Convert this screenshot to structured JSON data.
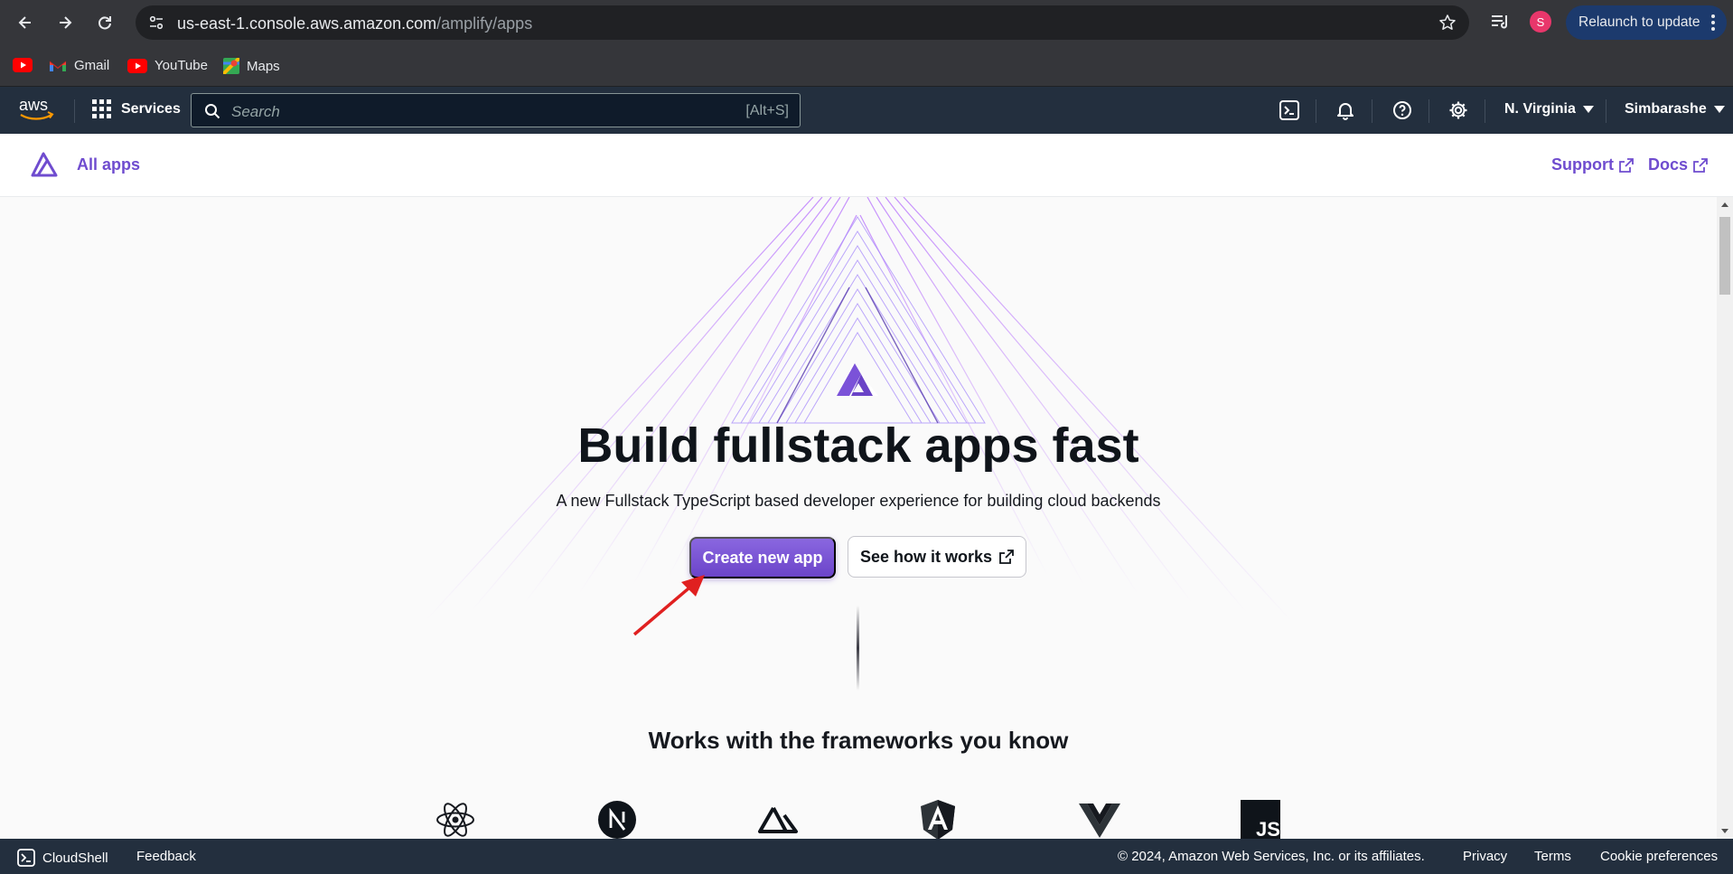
{
  "browser": {
    "url_host": "us-east-1.console.aws.amazon.com",
    "url_path": "/amplify/apps",
    "profile_initial": "S",
    "relaunch_label": "Relaunch to update",
    "bookmarks": [
      {
        "label": ""
      },
      {
        "label": "Gmail"
      },
      {
        "label": "YouTube"
      },
      {
        "label": "Maps"
      }
    ]
  },
  "aws_header": {
    "logo_text": "aws",
    "services_label": "Services",
    "search_placeholder": "Search",
    "search_shortcut": "[Alt+S]",
    "region": "N. Virginia",
    "account": "Simbarashe"
  },
  "amplify_header": {
    "all_apps": "All apps",
    "support": "Support",
    "docs": "Docs"
  },
  "hero": {
    "title": "Build fullstack apps fast",
    "subtitle": "A new Fullstack TypeScript based developer experience for building cloud backends",
    "primary_button": "Create new app",
    "secondary_button": "See how it works"
  },
  "frameworks": {
    "title": "Works with the frameworks you know",
    "icons": [
      "react-icon",
      "nextjs-icon",
      "nuxt-icon",
      "angular-icon",
      "vue-icon",
      "javascript-icon"
    ]
  },
  "footer": {
    "cloudshell": "CloudShell",
    "feedback": "Feedback",
    "copyright": "© 2024, Amazon Web Services, Inc. or its affiliates.",
    "privacy": "Privacy",
    "terms": "Terms",
    "cookie_preferences": "Cookie preferences"
  },
  "colors": {
    "aws_navy": "#232f3e",
    "amplify_purple": "#6f4ccf",
    "chrome_bar": "#35363a",
    "annotation_arrow": "#e02020"
  }
}
